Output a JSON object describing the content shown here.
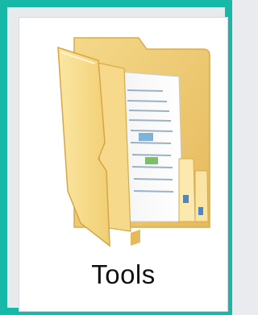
{
  "folder": {
    "name": "Tools",
    "icon": "folder-open-documents-icon"
  },
  "colors": {
    "frame_accent": "#18b8a8",
    "folder_yellow": "#f7d879",
    "folder_shadow": "#e6b95c"
  }
}
